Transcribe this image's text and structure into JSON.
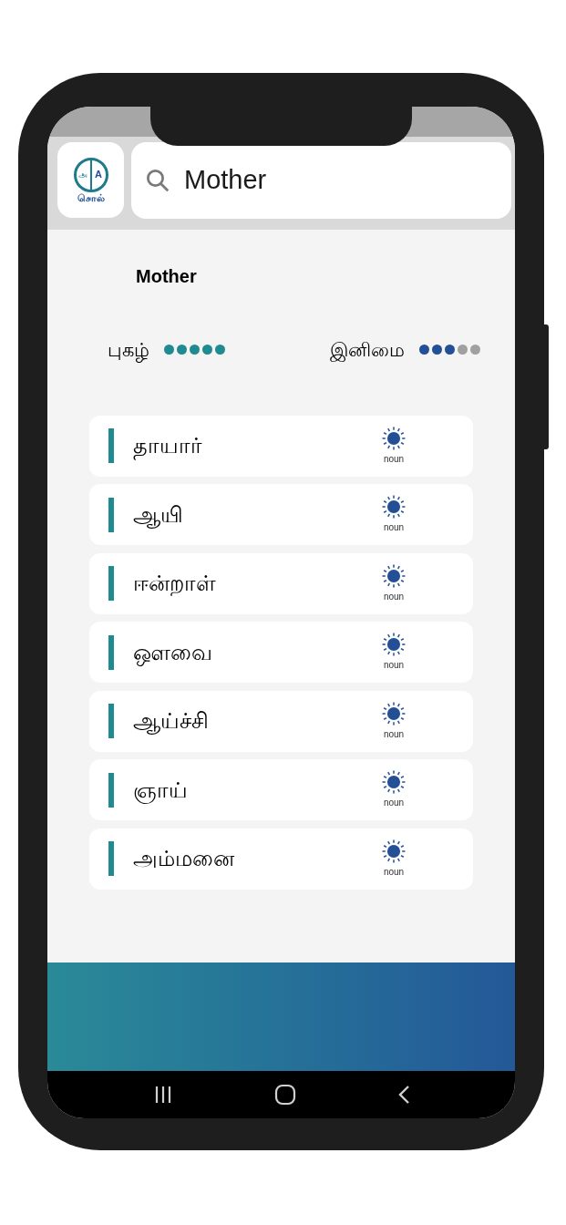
{
  "logo": {
    "letter_left": "அ",
    "letter_right": "A",
    "word": "சொல்"
  },
  "search": {
    "value": "Mother"
  },
  "headword": "Mother",
  "ratings": [
    {
      "label": "புகழ்",
      "stars": 5,
      "color": "#1f8a8f"
    },
    {
      "label": "இனிமை",
      "stars": 3,
      "color": "#234f96"
    }
  ],
  "words": [
    {
      "word": "தாயார்",
      "pos": "noun"
    },
    {
      "word": "ஆயி",
      "pos": "noun"
    },
    {
      "word": "ஈன்றாள்",
      "pos": "noun"
    },
    {
      "word": "ஔவை",
      "pos": "noun"
    },
    {
      "word": "ஆய்ச்சி",
      "pos": "noun"
    },
    {
      "word": "ஞாய்",
      "pos": "noun"
    },
    {
      "word": "அம்மனை",
      "pos": "noun"
    }
  ]
}
